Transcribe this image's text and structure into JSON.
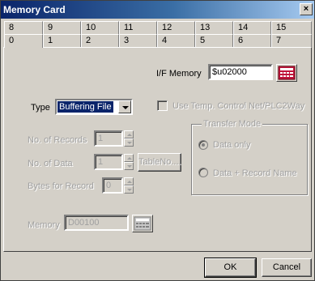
{
  "window": {
    "title": "Memory Card",
    "close": "×"
  },
  "tabs": {
    "row1": [
      "8",
      "9",
      "10",
      "11",
      "12",
      "13",
      "14",
      "15"
    ],
    "row2": [
      "0",
      "1",
      "2",
      "3",
      "4",
      "5",
      "6",
      "7"
    ],
    "active": "0"
  },
  "if_memory": {
    "label": "I/F Memory",
    "value": "$u02000"
  },
  "type": {
    "label": "Type",
    "selected": "Buffering File",
    "use_temp_label": "Use Temp. Control Net/PLC2Way"
  },
  "records": {
    "label": "No. of Records",
    "value": "1"
  },
  "data": {
    "label": "No. of Data",
    "value": "1",
    "tableno_button": "TableNo...."
  },
  "bytes": {
    "label": "Bytes for Record",
    "value": "0"
  },
  "transfer_mode": {
    "title": "Transfer Mode",
    "options": [
      "Data only",
      "Data + Record Name"
    ],
    "selected_index": 0
  },
  "memory": {
    "label": "Memory",
    "value": "D00100"
  },
  "buttons": {
    "ok": "OK",
    "cancel": "Cancel"
  },
  "colors": {
    "titlebar_start": "#0a246a",
    "titlebar_end": "#a6caf0",
    "dialog_face": "#d4d0c8",
    "calc_icon": "#c0143c"
  }
}
